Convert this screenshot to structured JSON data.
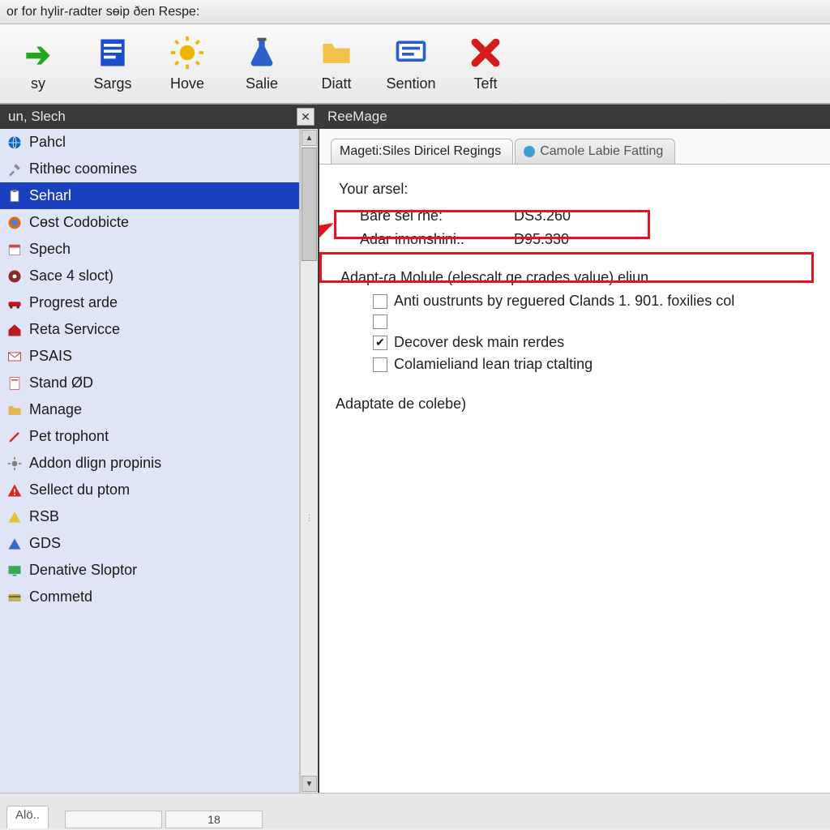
{
  "title": "or for hylir-ɾadter sɵip  ðen Respe:",
  "toolbar": [
    {
      "name": "sy",
      "label": "sy",
      "icon": "green-arrow",
      "color": "#1da81d"
    },
    {
      "name": "sargs",
      "label": "Sargs",
      "icon": "blue-doc",
      "color": "#1a4fcc"
    },
    {
      "name": "hove",
      "label": "Hove",
      "icon": "sun",
      "color": "#f0b400"
    },
    {
      "name": "salie",
      "label": "Salie",
      "icon": "flask",
      "color": "#2b5fcc"
    },
    {
      "name": "diatt",
      "label": "Diatt",
      "icon": "folder",
      "color": "#f2c24a"
    },
    {
      "name": "sention",
      "label": "Sention",
      "icon": "device",
      "color": "#2b5fcc"
    },
    {
      "name": "teft",
      "label": "Teft",
      "icon": "x",
      "color": "#d61b1b"
    }
  ],
  "left_panel": {
    "title": "un, Slech",
    "selected_index": 2,
    "items": [
      {
        "label": "Pahcl",
        "icon": "globe",
        "color": "#0b62c4"
      },
      {
        "label": "Rithɵc coomines",
        "icon": "tools",
        "color": "#8a8a8a"
      },
      {
        "label": "Seharl",
        "icon": "clipboard",
        "color": "#7a7a7a"
      },
      {
        "label": "Cɵst Codobicte",
        "icon": "firefox",
        "color": "#e06a0a"
      },
      {
        "label": "Spech",
        "icon": "calendar",
        "color": "#d04848"
      },
      {
        "label": "Sace 4 sloct)",
        "icon": "disc",
        "color": "#8a2a2a"
      },
      {
        "label": "Progrest arde",
        "icon": "car",
        "color": "#c01515"
      },
      {
        "label": "Reta Servicce",
        "icon": "house",
        "color": "#b81c1c"
      },
      {
        "label": "PSAIS",
        "icon": "mail",
        "color": "#b52a2a"
      },
      {
        "label": "Stand ØD",
        "icon": "page",
        "color": "#cc5a5a"
      },
      {
        "label": "Manage",
        "icon": "folder",
        "color": "#e3b850"
      },
      {
        "label": "Pet trophont",
        "icon": "pencil",
        "color": "#cc2a2a"
      },
      {
        "label": "Addon dlign propinis",
        "icon": "gear",
        "color": "#808080"
      },
      {
        "label": "Sellect du ptom",
        "icon": "warning",
        "color": "#d62828"
      },
      {
        "label": "RSB",
        "icon": "tri-y",
        "color": "#e3c23a"
      },
      {
        "label": "GDS",
        "icon": "tri-b",
        "color": "#3a68c4"
      },
      {
        "label": "Denative Sloptor",
        "icon": "display",
        "color": "#3aa85a"
      },
      {
        "label": "Commetd",
        "icon": "card",
        "color": "#c8b050"
      }
    ]
  },
  "right_panel": {
    "title": "ReeMage",
    "tabs": [
      {
        "label": "Mageti:Siles Diricel Reɡings",
        "active": true,
        "dot": null
      },
      {
        "label": "Camole Labie Fatting",
        "active": false,
        "dot": "#3aa0d8"
      }
    ],
    "section_label": "Your arsel:",
    "kv": [
      {
        "k": "Bare sel ɾhe:",
        "v": "DS3.260"
      },
      {
        "k": "Adar imonshini..",
        "v": "D95.330"
      }
    ],
    "fieldset_label": "Adapt-ɾa Molule (elescalt qe crades value) eliun",
    "checks": [
      {
        "checked": false,
        "label": "Anti oustrunts by reɡuered Clands 1. 901. foxilies col"
      },
      {
        "checked": false,
        "label": ""
      },
      {
        "checked": true,
        "label": "Decover desk main rerdes"
      },
      {
        "checked": false,
        "label": "Colamieliand lean triap ctalting"
      }
    ],
    "subhead": "Adaptate de colebe)"
  },
  "statusbar": {
    "cell1": "",
    "cell2": "18",
    "tab": "Alö.."
  }
}
